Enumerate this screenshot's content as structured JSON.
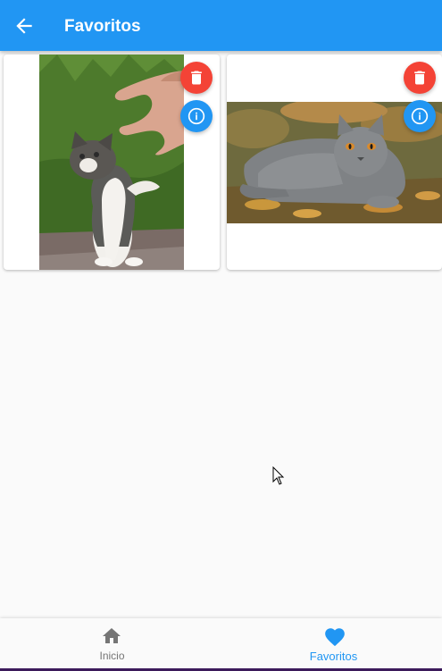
{
  "appbar": {
    "title": "Favoritos",
    "back_icon": "arrow-back-icon"
  },
  "favorites": [
    {
      "image": "kitten-with-hand-photo",
      "delete_icon": "trash-icon",
      "info_icon": "info-icon"
    },
    {
      "image": "gray-british-cat-photo",
      "delete_icon": "trash-icon",
      "info_icon": "info-icon"
    }
  ],
  "bottom_nav": {
    "items": [
      {
        "label": "Inicio",
        "icon": "home-icon",
        "active": false
      },
      {
        "label": "Favoritos",
        "icon": "heart-icon",
        "active": true
      }
    ]
  },
  "colors": {
    "primary": "#2196f3",
    "delete": "#f44336",
    "inactive": "#757575",
    "background": "#fafafa"
  }
}
